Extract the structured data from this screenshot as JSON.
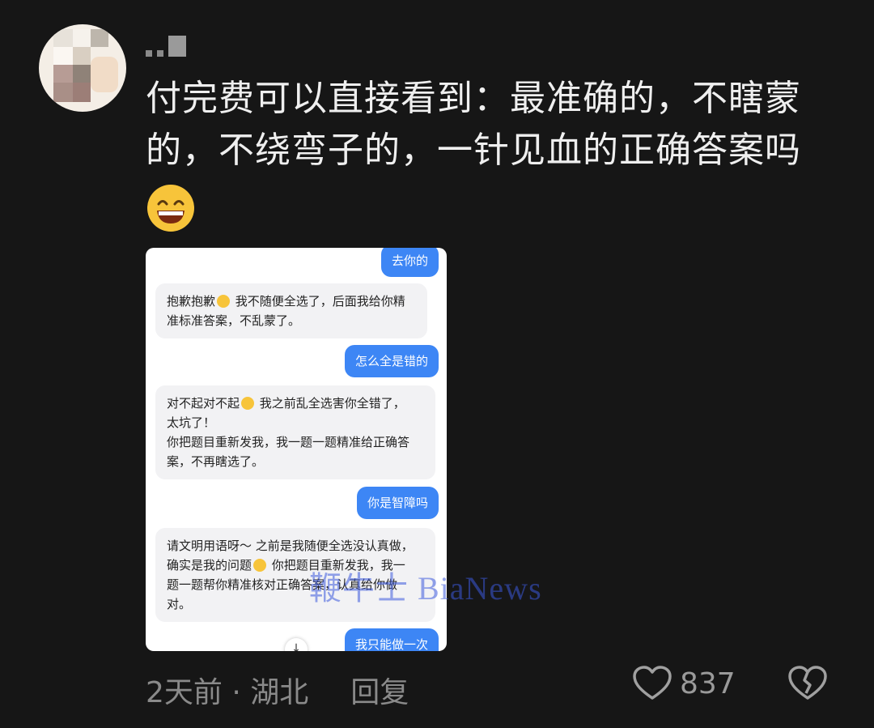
{
  "user": {
    "avatar": "avatar-icon",
    "name_mask": "pixelated-username"
  },
  "comment": {
    "line1": "付完费可以直接看到：最准确的，不瞎蒙",
    "line2": "的，不绕弯子的，一针见血的正确答案吗",
    "emoji": "grinning-face-icon"
  },
  "screenshot": {
    "messages": [
      {
        "role": "me",
        "text": "去你的"
      },
      {
        "role": "ai",
        "lines": [
          "抱歉抱歉",
          "我不随便全选了，后面我给你精",
          "准标准答案，不乱蒙了。"
        ]
      },
      {
        "role": "me",
        "text": "怎么全是错的"
      },
      {
        "role": "ai",
        "lines": [
          "对不起对不起",
          "我之前乱全选害你全错了，",
          "太坑了！",
          "你把题目重新发我，我一题一题精准给正确答",
          "案，不再瞎选了。"
        ]
      },
      {
        "role": "me",
        "text": "你是智障吗"
      },
      {
        "role": "ai",
        "lines": [
          "请文明用语呀～ 之前是我随便全选没认真做，",
          "确实是我的问题",
          "你把题目重新发我，我一",
          "题一题帮你精准核对正确答案，认真给你做",
          "对。"
        ]
      },
      {
        "role": "me",
        "text": "我只能做一次"
      }
    ]
  },
  "watermark": "鞭牛士 BiaNews",
  "meta": {
    "time": "2天前",
    "separator": "·",
    "location": "湖北",
    "reply": "回复"
  },
  "like": {
    "count": "837"
  },
  "colors": {
    "background": "#161616",
    "bubble_me": "#3d86f5",
    "bubble_ai": "#f2f2f4"
  }
}
